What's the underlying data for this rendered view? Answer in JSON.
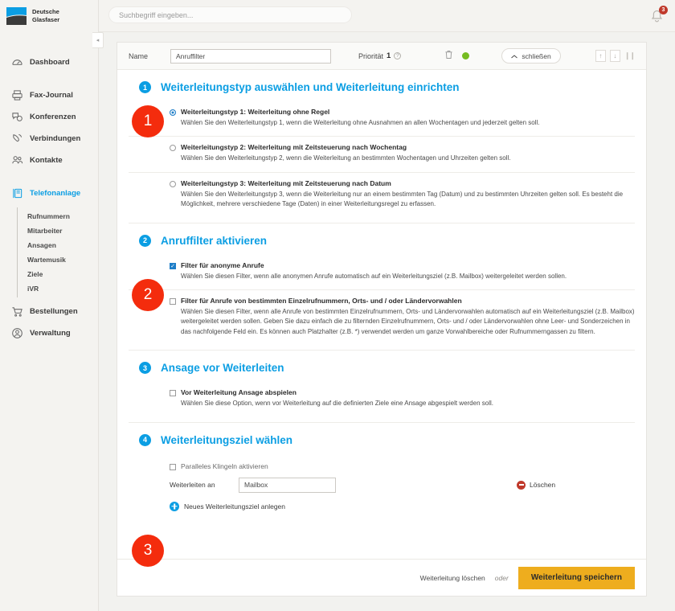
{
  "brand": {
    "name_line1": "Deutsche",
    "name_line2": "Glasfaser",
    "accent": "#0b9ee3",
    "annotation_color": "#f42c0d",
    "save_color": "#eead1e"
  },
  "topbar": {
    "search_placeholder": "Suchbegriff eingeben...",
    "search_value": "",
    "bell_badge": "3"
  },
  "sidebar": {
    "items": [
      {
        "label": "Dashboard",
        "icon": "gauge-icon",
        "active": false
      },
      {
        "label": "Fax-Journal",
        "icon": "printer-icon",
        "active": false
      },
      {
        "label": "Konferenzen",
        "icon": "chat-icon",
        "active": false
      },
      {
        "label": "Verbindungen",
        "icon": "phone-icon",
        "active": false
      },
      {
        "label": "Kontakte",
        "icon": "contacts-icon",
        "active": false
      },
      {
        "label": "Telefonanlage",
        "icon": "pbx-icon",
        "active": true
      },
      {
        "label": "Bestellungen",
        "icon": "cart-icon",
        "active": false
      },
      {
        "label": "Verwaltung",
        "icon": "user-circle-icon",
        "active": false
      }
    ],
    "subitems": [
      "Rufnummern",
      "Mitarbeiter",
      "Ansagen",
      "Wartemusik",
      "Ziele",
      "iVR"
    ]
  },
  "card_header": {
    "name_label": "Name",
    "name_value": "Anruffilter",
    "priority_label": "Priorität",
    "priority_value": "1",
    "info_icon": "?",
    "close_label": "schließen"
  },
  "section1": {
    "number": "1",
    "title": "Weiterleitungstyp auswählen und Weiterleitung einrichten",
    "options": [
      {
        "checked": true,
        "title": "Weiterleitungstyp 1: Weiterleitung ohne Regel",
        "desc": "Wählen Sie den Weiterleitungstyp 1, wenn die Weiterleitung ohne Ausnahmen an allen Wochentagen und jederzeit gelten soll."
      },
      {
        "checked": false,
        "title": "Weiterleitungstyp 2: Weiterleitung mit Zeitsteuerung nach Wochentag",
        "desc": "Wählen Sie den Weiterleitungstyp 2, wenn die Weiterleitung an bestimmten Wochentagen und Uhrzeiten gelten soll."
      },
      {
        "checked": false,
        "title": "Weiterleitungstyp 3: Weiterleitung mit Zeitsteuerung nach Datum",
        "desc": "Wählen Sie den Weiterleitungstyp 3, wenn die Weiterleitung nur an einem bestimmten Tag (Datum) und zu bestimmten Uhrzeiten gelten soll. Es besteht die Möglichkeit, mehrere verschiedene Tage (Daten) in einer Weiterleitungsregel zu erfassen."
      }
    ]
  },
  "section2": {
    "number": "2",
    "title": "Anruffilter aktivieren",
    "options": [
      {
        "checked": true,
        "title": "Filter für anonyme Anrufe",
        "desc": "Wählen Sie diesen Filter, wenn alle anonymen Anrufe automatisch auf ein Weiterleitungsziel (z.B. Mailbox) weitergeleitet werden sollen."
      },
      {
        "checked": false,
        "title": "Filter für Anrufe von bestimmten Einzelrufnummern, Orts- und / oder Ländervorwahlen",
        "desc": "Wählen Sie diesen Filter, wenn alle Anrufe von bestimmten Einzelrufnummern, Orts- und Ländervorwahlen automatisch auf ein Weiterleitungsziel (z.B. Mailbox) weitergeleitet werden sollen. Geben Sie dazu einfach die zu filternden Einzelrufnummern, Orts- und / oder Ländervorwahlen ohne Leer- und Sonderzeichen in das nachfolgende Feld ein. Es können auch Platzhalter (z.B. *) verwendet werden um ganze Vorwahlbereiche oder Rufnummerngassen zu filtern."
      }
    ]
  },
  "section3": {
    "number": "3",
    "title": "Ansage vor Weiterleiten",
    "options": [
      {
        "checked": false,
        "title": "Vor Weiterleitung Ansage abspielen",
        "desc": "Wählen Sie diese Option, wenn vor Weiterleitung auf die definierten Ziele eine Ansage abgespielt werden soll."
      }
    ]
  },
  "section4": {
    "number": "4",
    "title": "Weiterleitungsziel wählen",
    "parallel_ring_label": "Paralleles Klingeln aktivieren",
    "parallel_ring_checked": false,
    "forward_to_label": "Weiterleiten an",
    "forward_to_value": "Mailbox",
    "delete_label": "Löschen",
    "add_label": "Neues Weiterleitungsziel anlegen"
  },
  "footer": {
    "delete_link": "Weiterleitung löschen",
    "or": "oder",
    "save_label": "Weiterleitung speichern"
  },
  "annotations": [
    {
      "label": "1"
    },
    {
      "label": "2"
    },
    {
      "label": "3"
    }
  ]
}
